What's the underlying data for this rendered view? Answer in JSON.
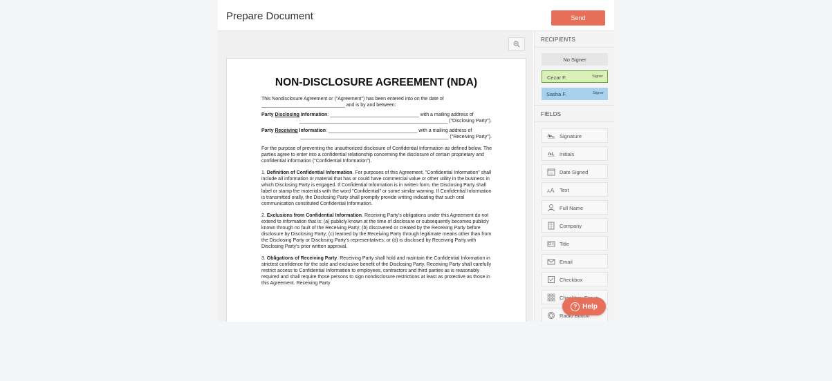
{
  "header": {
    "title": "Prepare Document",
    "send_label": "Send"
  },
  "document": {
    "title": "NON-DISCLOSURE AGREEMENT (NDA)",
    "intro_1": "This Nondisclosure Agreement or (\"Agreement\") has been entered into on the date of",
    "intro_2": "_______________________________ and is by and between:",
    "disclosing_label": "Party",
    "disclosing_word": "Disclosing",
    "disclosing_rest": "Information",
    "disclosing_line": ": _________________________________ with a mailing address of",
    "disclosing_line2": "_______________________________________________________ (\"Disclosing Party\").",
    "receiving_label": "Party",
    "receiving_word": "Receiving",
    "receiving_rest": "Information",
    "receiving_line": ": _________________________________ with a mailing address of",
    "receiving_line2": "_______________________________________________________ (\"Receiving Party\").",
    "purpose": "For the purpose of preventing the unauthorized disclosure of Confidential Information as defined below. The parties agree to enter into a confidential relationship concerning the disclosure of certain proprietary and confidential information (\"Confidential Information\").",
    "s1_num": "1.",
    "s1_head": "Definition of Confidential Information",
    "s1_text": ". For purposes of this Agreement, \"Confidential Information\" shall include all information or material that has or could have commercial value or other utility in the business in which Disclosing Party is engaged. If Confidential Information is in written form, the Disclosing Party shall label or stamp the materials with the word \"Confidential\" or some similar warning. If Confidential Information is transmitted orally, the Disclosing Party shall promptly provide writing indicating that such oral communication constituted Confidential Information.",
    "s2_num": "2.",
    "s2_head": "Exclusions from Confidential Information",
    "s2_text": ". Receiving Party's obligations under this Agreement do not extend to information that is: (a) publicly known at the time of disclosure or subsequently becomes publicly known through no fault of the Receiving Party; (b) discovered or created by the Receiving Party before disclosure by Disclosing Party; (c) learned by the Receiving Party through legitimate means other than from the Disclosing Party or Disclosing Party's representatives; or (d) is disclosed by Receiving Party with Disclosing Party's prior written approval.",
    "s3_num": "3.",
    "s3_head": "Obligations of Receiving Party",
    "s3_text": ". Receiving Party shall hold and maintain the Confidential Information in strictest confidence for the sole and exclusive benefit of the Disclosing Party. Receiving Party shall carefully restrict access to Confidential Information to employees, contractors and third parties as is reasonably required and shall require those persons to sign nondisclosure restrictions at least as protective as those in this Agreement. Receiving Party"
  },
  "sidebar": {
    "recipients_label": "RECIPIENTS",
    "recipients": [
      {
        "name": "No Signer",
        "role": ""
      },
      {
        "name": "Cezar F.",
        "role": "Signer"
      },
      {
        "name": "Sasha F.",
        "role": "Signer"
      }
    ],
    "fields_label": "FIELDS",
    "fields": [
      {
        "label": "Signature",
        "icon": "signature-icon"
      },
      {
        "label": "Initials",
        "icon": "initials-icon"
      },
      {
        "label": "Date Signed",
        "icon": "calendar-icon"
      },
      {
        "label": "Text",
        "icon": "text-icon"
      },
      {
        "label": "Full Name",
        "icon": "person-icon"
      },
      {
        "label": "Company",
        "icon": "building-icon"
      },
      {
        "label": "Title",
        "icon": "id-card-icon"
      },
      {
        "label": "Email",
        "icon": "envelope-icon"
      },
      {
        "label": "Checkbox",
        "icon": "checkbox-icon"
      },
      {
        "label": "Checkbox Group",
        "icon": "checkbox-group-icon"
      },
      {
        "label": "Radio Button",
        "icon": "radio-icon"
      }
    ]
  },
  "help": {
    "label": "Help",
    "icon": "question-icon"
  },
  "colors": {
    "accent": "#e8705a",
    "cezar": "#d9f1b9",
    "sasha": "#a8d1ee"
  }
}
